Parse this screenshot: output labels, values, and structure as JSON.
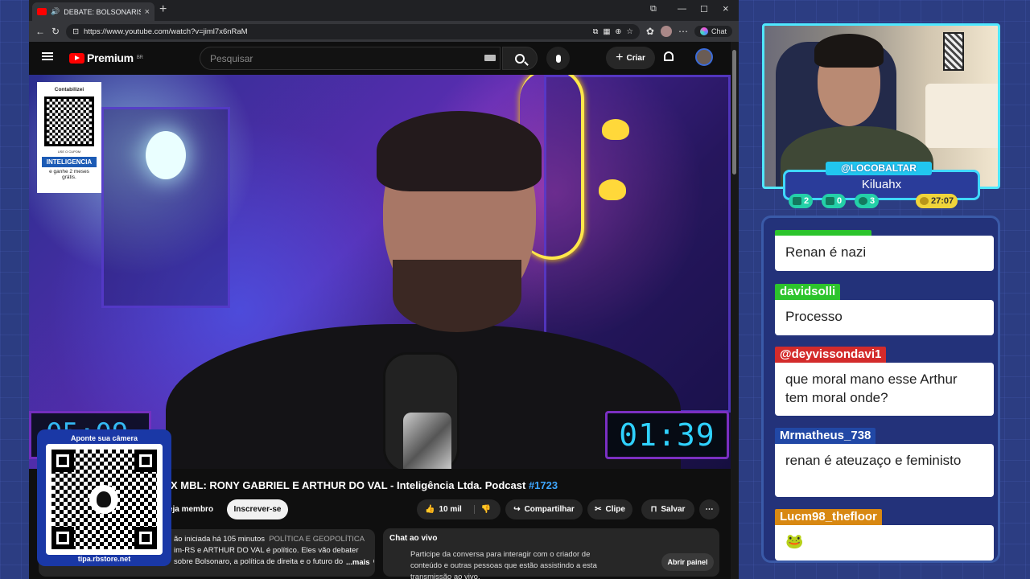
{
  "browser": {
    "tab_title": "DEBATE: BOLSONARISTA X MBL",
    "url": "https://www.youtube.com/watch?v=jiml7x6nRaM",
    "chat_button": "Chat"
  },
  "youtube": {
    "logo": "Premium",
    "logo_region": "BR",
    "search_placeholder": "Pesquisar",
    "create_label": "Criar",
    "video_title_visible": "X MBL: RONY GABRIEL E ARTHUR DO VAL - Inteligência Ltda. Podcast ",
    "video_hashtag": "#1723",
    "member_label": "eja membro",
    "subscribe_label": "Inscrever-se",
    "likes": "10 mil",
    "share_label": "Compartilhar",
    "clip_label": "Clipe",
    "save_label": "Salvar",
    "desc_line1": "ão iniciada há 105 minutos",
    "desc_topic": "POLÍTICA E GEOPOLÍTICA",
    "desc_line2": "im-RS e ARTHUR DO VAL é político. Eles vão debater",
    "desc_line3": "sobre Bolsonaro, a política de direita e o futuro do Brasil. O Vilela se preocupa muito",
    "desc_more": "...mais",
    "live_chat_title": "Chat ao vivo",
    "live_chat_text": "Participe da conversa para interagir com o criador de conteúdo e outras pessoas que estão assistindo a esta transmissão ao vivo.",
    "open_panel": "Abrir painel"
  },
  "video_overlay": {
    "promo_header": "Contabilizei",
    "promo_small": "USE O CUPOM",
    "promo_code": "INTELIGENCIA",
    "promo_text": "e ganhe 2 meses grátis.",
    "timer": "01:39",
    "timer_left": "05:09"
  },
  "stream_overlay": {
    "qr_label": "Aponte sua câmera",
    "qr_url": "tipa.rbstore.net",
    "streamer_tag": "@LOCOBALTAR",
    "streamer_name": "Kiluahx",
    "stat_chat": "2",
    "stat_yt": "0",
    "stat_other": "3",
    "stat_time": "27:07"
  },
  "chat": [
    {
      "user": "",
      "text": "Renan é nazi",
      "color": "#2cc42c"
    },
    {
      "user": "davidsolli",
      "text": "Processo",
      "color": "#2cc42c"
    },
    {
      "user": "@deyvissondavi1",
      "text": "que moral mano esse Arthur tem moral onde?",
      "color": "#d32b2b"
    },
    {
      "user": "Mrmatheus_738",
      "text": "renan é ateuzaço e feministo",
      "color": "#2148a6"
    },
    {
      "user": "Lucm98_thefloor",
      "text": "🐸",
      "color": "#d88812"
    }
  ]
}
